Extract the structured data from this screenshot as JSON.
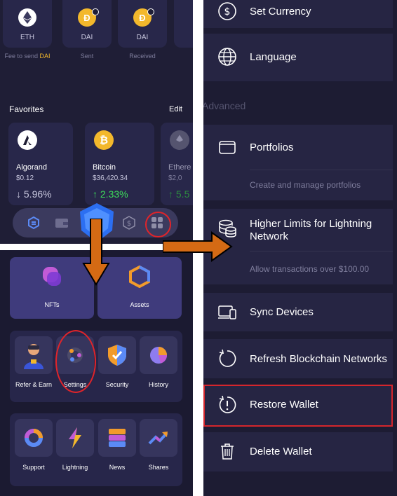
{
  "left": {
    "coins": [
      {
        "symbol": "ETH",
        "icon": "eth-icon",
        "color": "#e8e8ee"
      },
      {
        "symbol": "DAI",
        "icon": "dai-icon",
        "color": "#f3b82c"
      },
      {
        "symbol": "DAI",
        "icon": "dai-icon",
        "color": "#f3b82c"
      }
    ],
    "coin_subs": {
      "fee_prefix": "Fee to send ",
      "fee_token": "DAI",
      "sent": "Sent",
      "received": "Received"
    },
    "favorites": {
      "title": "Favorites",
      "edit": "Edit",
      "items": [
        {
          "name": "Algorand",
          "price": "$0.12",
          "change": "↓ 5.96%",
          "direction": "down",
          "icon": "algorand-icon"
        },
        {
          "name": "Bitcoin",
          "price": "$36,420.34",
          "change": "↑ 2.33%",
          "direction": "up",
          "icon": "bitcoin-icon"
        },
        {
          "name": "Ethere",
          "price": "$2,0",
          "change": "↑ 5.5",
          "direction": "up",
          "icon": "ethereum-icon"
        }
      ]
    },
    "big_cards": [
      {
        "label": "NFTs",
        "icon": "nfts-icon"
      },
      {
        "label": "Assets",
        "icon": "assets-icon"
      }
    ],
    "group1": [
      "Refer & Earn",
      "Settings",
      "Security",
      "History"
    ],
    "group2": [
      "Support",
      "Lightning",
      "News",
      "Shares"
    ]
  },
  "right": {
    "set_currency": "Set Currency",
    "language": "Language",
    "advanced": "Advanced",
    "portfolios": "Portfolios",
    "portfolios_sub": "Create and manage portfolios",
    "higher_limits": "Higher Limits for Lightning Network",
    "higher_limits_sub": "Allow transactions over $100.00",
    "sync_devices": "Sync Devices",
    "refresh_networks": "Refresh Blockchain Networks",
    "restore_wallet": "Restore Wallet",
    "delete_wallet": "Delete Wallet"
  },
  "colors": {
    "accent_orange": "#d46a14",
    "highlight_red": "#e0242a",
    "positive": "#3ddc5a",
    "negative": "#c7c6dd"
  }
}
